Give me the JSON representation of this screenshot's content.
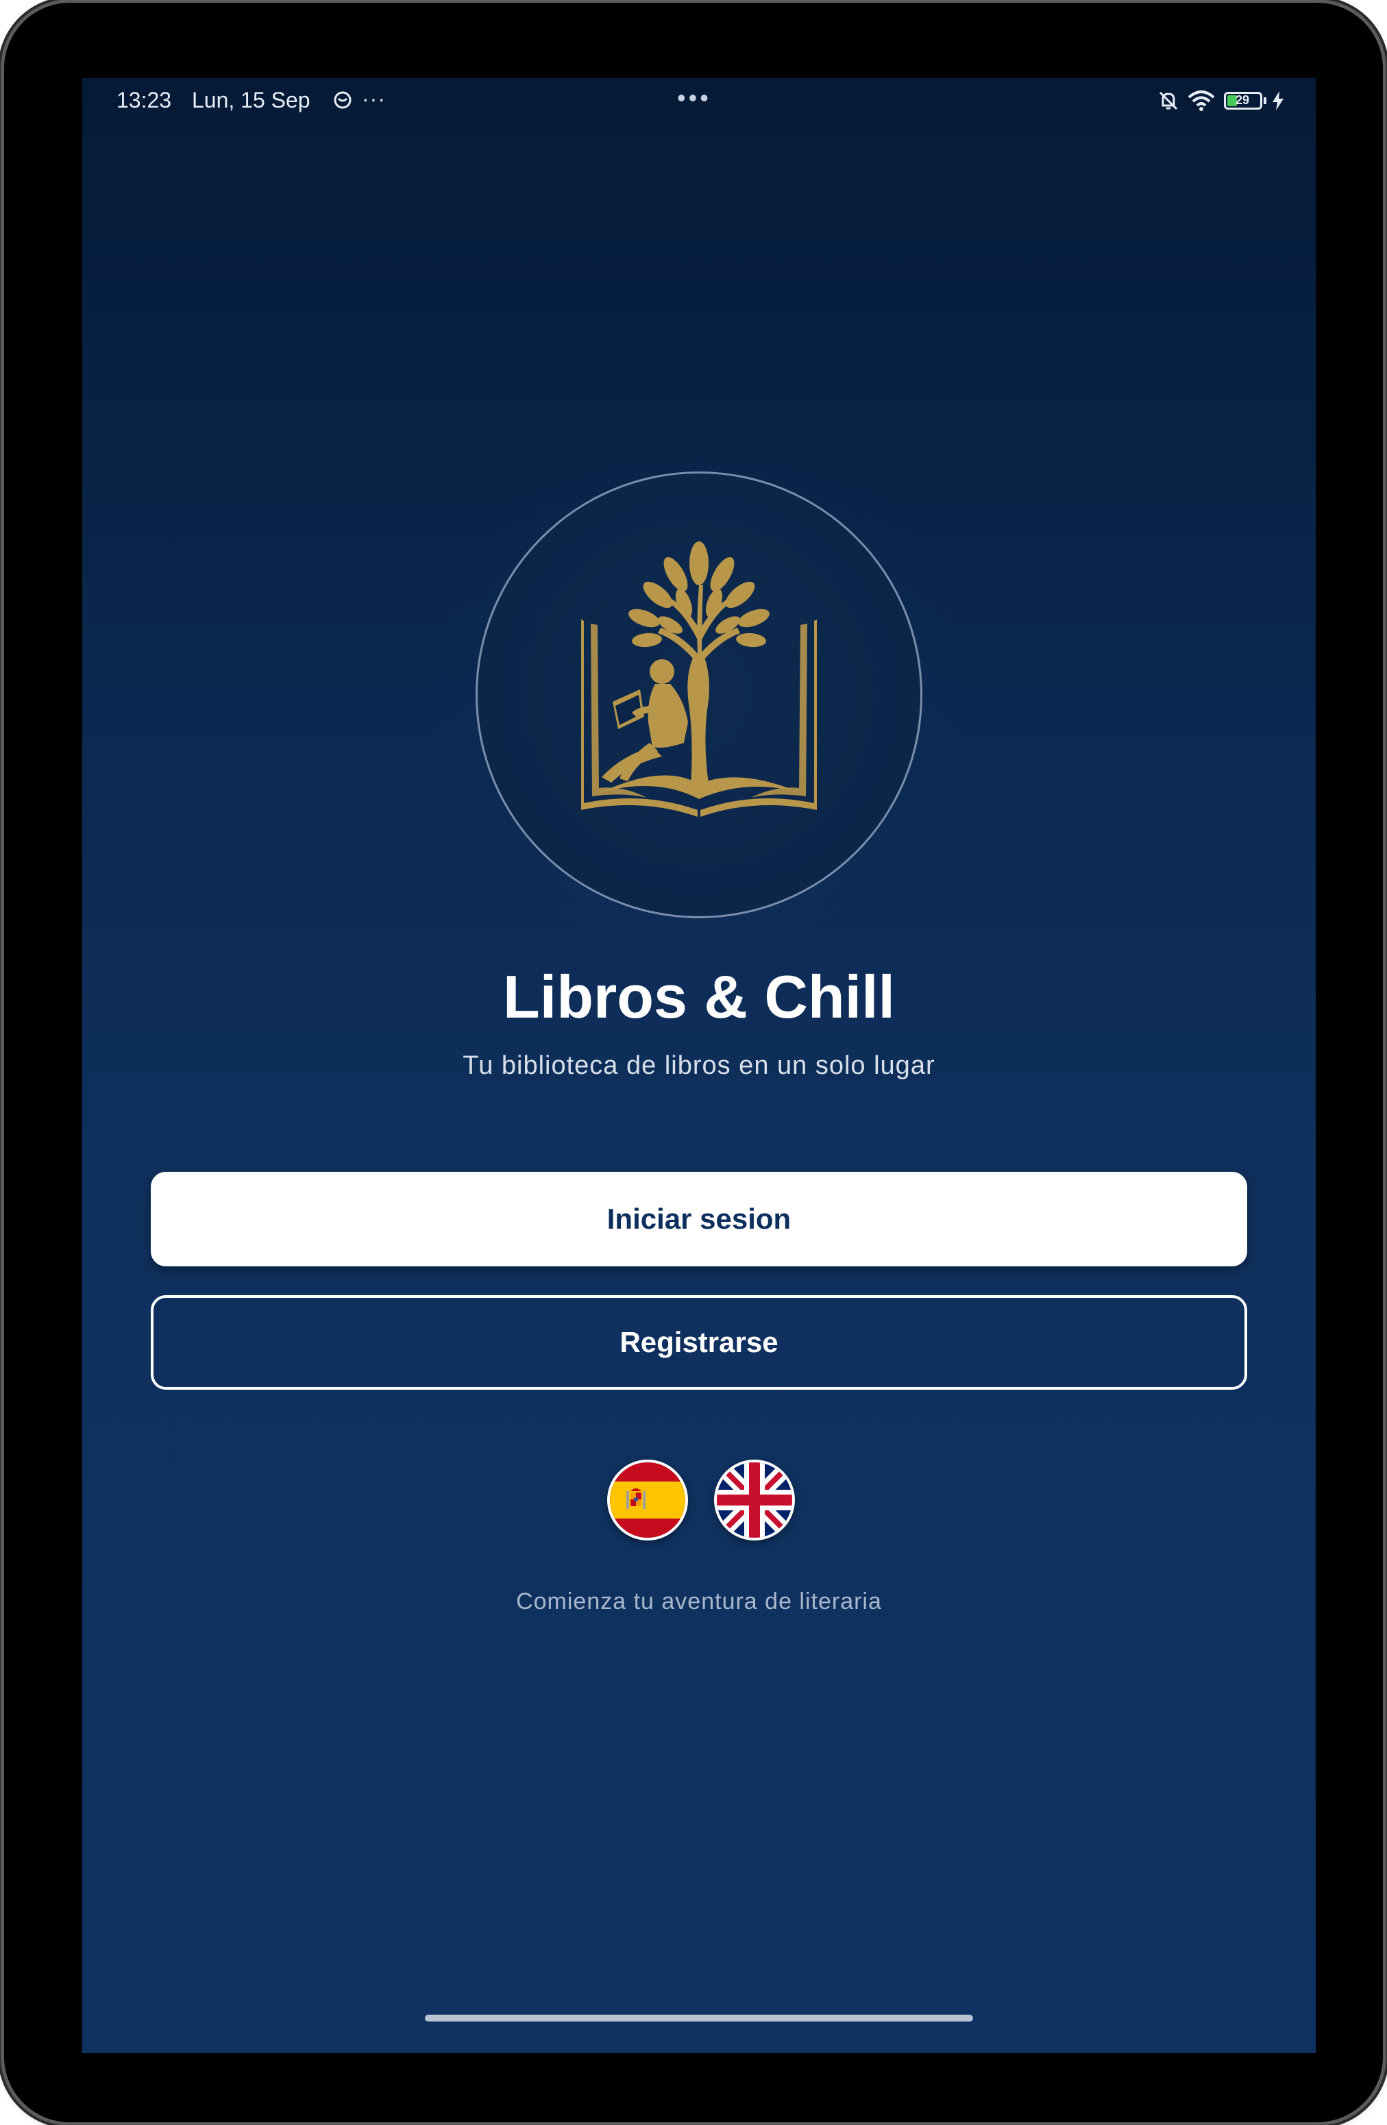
{
  "status_bar": {
    "time": "13:23",
    "date": "Lun, 15 Sep",
    "more": "···",
    "center_dots": "•••",
    "battery_level": "29",
    "icons": [
      "notification-icon",
      "more-icon",
      "mute-icon",
      "wifi-icon",
      "battery-icon",
      "charging-icon"
    ]
  },
  "app": {
    "title": "Libros & Chill",
    "subtitle": "Tu biblioteca de libros en un solo lugar",
    "logo_icon": "reader-under-tree-book-icon"
  },
  "actions": {
    "login_label": "Iniciar sesion",
    "register_label": "Registrarse"
  },
  "languages": [
    {
      "code": "es",
      "icon": "spain-flag-icon"
    },
    {
      "code": "en",
      "icon": "uk-flag-icon"
    }
  ],
  "tagline": "Comienza tu aventura de literaria",
  "colors": {
    "background_top": "#051a36",
    "background_bottom": "#0f3262",
    "accent_gold": "#b8964a",
    "button_primary_bg": "#ffffff",
    "button_primary_text": "#0d2f5e"
  }
}
